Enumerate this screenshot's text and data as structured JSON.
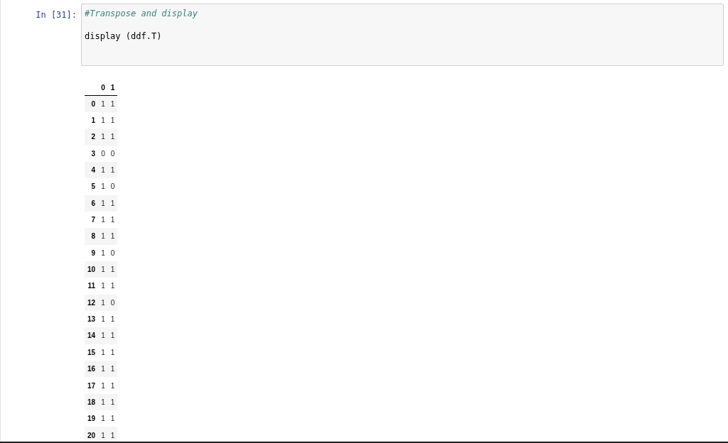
{
  "cell": {
    "prompt": "In [31]:",
    "code_lines": [
      {
        "kind": "comment",
        "text": "#Transpose and display"
      },
      {
        "kind": "code",
        "text": "display (ddf.T)"
      }
    ]
  },
  "output_table": {
    "columns": [
      "0",
      "1"
    ],
    "rows": [
      {
        "index": "0",
        "values": [
          "1",
          "1"
        ]
      },
      {
        "index": "1",
        "values": [
          "1",
          "1"
        ]
      },
      {
        "index": "2",
        "values": [
          "1",
          "1"
        ]
      },
      {
        "index": "3",
        "values": [
          "0",
          "0"
        ]
      },
      {
        "index": "4",
        "values": [
          "1",
          "1"
        ]
      },
      {
        "index": "5",
        "values": [
          "1",
          "0"
        ]
      },
      {
        "index": "6",
        "values": [
          "1",
          "1"
        ]
      },
      {
        "index": "7",
        "values": [
          "1",
          "1"
        ]
      },
      {
        "index": "8",
        "values": [
          "1",
          "1"
        ]
      },
      {
        "index": "9",
        "values": [
          "1",
          "0"
        ]
      },
      {
        "index": "10",
        "values": [
          "1",
          "1"
        ]
      },
      {
        "index": "11",
        "values": [
          "1",
          "1"
        ]
      },
      {
        "index": "12",
        "values": [
          "1",
          "0"
        ]
      },
      {
        "index": "13",
        "values": [
          "1",
          "1"
        ]
      },
      {
        "index": "14",
        "values": [
          "1",
          "1"
        ]
      },
      {
        "index": "15",
        "values": [
          "1",
          "1"
        ]
      },
      {
        "index": "16",
        "values": [
          "1",
          "1"
        ]
      },
      {
        "index": "17",
        "values": [
          "1",
          "1"
        ]
      },
      {
        "index": "18",
        "values": [
          "1",
          "1"
        ]
      },
      {
        "index": "19",
        "values": [
          "1",
          "1"
        ]
      },
      {
        "index": "20",
        "values": [
          "1",
          "1"
        ]
      }
    ]
  }
}
